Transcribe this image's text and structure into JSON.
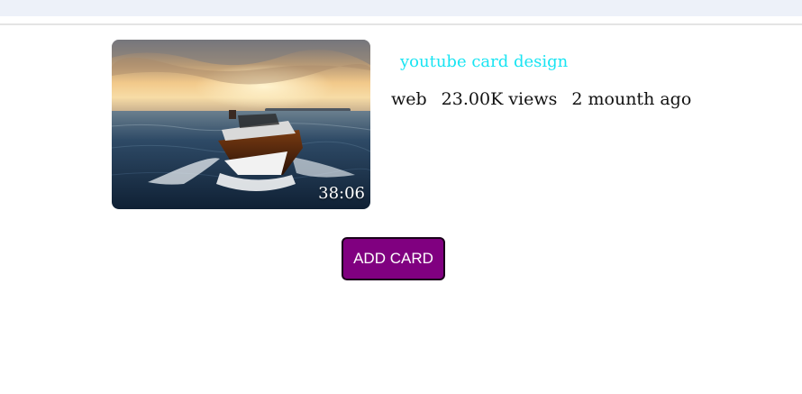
{
  "colors": {
    "title": "#19e4f2",
    "button_bg": "#800080",
    "top_bar": "#edf1f9"
  },
  "video_card": {
    "thumbnail": "boat-on-sea-at-sunset",
    "duration": "38:06",
    "title": "youtube card design",
    "channel": "web",
    "views": "23.00K views",
    "uploaded": "2 mounth ago"
  },
  "actions": {
    "add_card_label": "ADD CARD"
  }
}
